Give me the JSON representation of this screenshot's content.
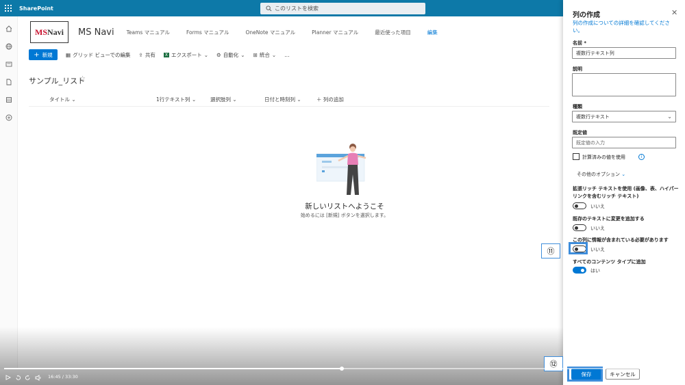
{
  "topbar": {
    "brand": "SharePoint",
    "search_placeholder": "このリストを検索"
  },
  "site": {
    "logo_text_ms": "MS",
    "logo_text_navi": "Navi",
    "title": "MS Navi",
    "nav": [
      "Teams マニュアル",
      "Forms マニュアル",
      "OneNote マニュアル",
      "Planner マニュアル",
      "最近使った項目"
    ],
    "nav_edit": "編集"
  },
  "commands": {
    "new": "新規",
    "grid_edit": "グリッド ビューでの編集",
    "share": "共有",
    "export": "エクスポート",
    "automate": "自動化",
    "integrate": "統合",
    "more": "…"
  },
  "list": {
    "title": "サンプル_リスト",
    "columns": [
      "タイトル",
      "1行テキスト列",
      "選択肢列",
      "日付と時刻列",
      "＋ 列の追加"
    ],
    "welcome_title": "新しいリストへようこそ",
    "welcome_sub": "始めるには [新規] ボタンを選択します。"
  },
  "panel": {
    "title": "列の作成",
    "help_link": "列の作成についての詳細を確認してください。",
    "name_label": "名前 *",
    "name_value": "複数行テキスト列",
    "desc_label": "説明",
    "type_label": "種類",
    "type_value": "複数行テキスト",
    "default_label": "既定値",
    "default_placeholder": "既定値の入力",
    "calc_label": "計算済みの値を使用",
    "more_options": "その他のオプション",
    "q1": "拡張リッチ テキストを使用 (画像、表、ハイパーリンクを含むリッチ テキスト)",
    "q1_state": "いいえ",
    "q2": "既存のテキストに変更を追加する",
    "q2_state": "いいえ",
    "q3": "この列に情報が含まれている必要があります",
    "q3_state": "いいえ",
    "q4": "すべてのコンテンツ タイプに追加",
    "q4_state": "はい",
    "save": "保存",
    "cancel": "キャンセル"
  },
  "callouts": {
    "c11": "⑪",
    "c12": "⑫"
  },
  "video": {
    "time": "16:45 / 33:30",
    "progress": 0.5
  },
  "colors": {
    "accent": "#0078d4",
    "topbar": "#0d79a8",
    "highlight": "#3e8ddb"
  }
}
